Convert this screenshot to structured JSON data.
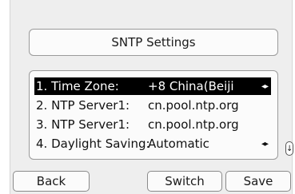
{
  "title": "SNTP Settings",
  "items": [
    {
      "label": "1. Time Zone:",
      "value": "+8 China(Beiji",
      "arrows": "◂▸",
      "selected": true
    },
    {
      "label": "2. NTP Server1:",
      "value": "cn.pool.ntp.org",
      "arrows": ""
    },
    {
      "label": "3. NTP Server1:",
      "value": "cn.pool.ntp.org",
      "arrows": ""
    },
    {
      "label": "4. Daylight Saving:",
      "value": "Automatic",
      "arrows": "◂▸"
    }
  ],
  "scroll_indicator": "↓",
  "softkeys": {
    "back": "Back",
    "switch": "Switch",
    "save": "Save"
  }
}
